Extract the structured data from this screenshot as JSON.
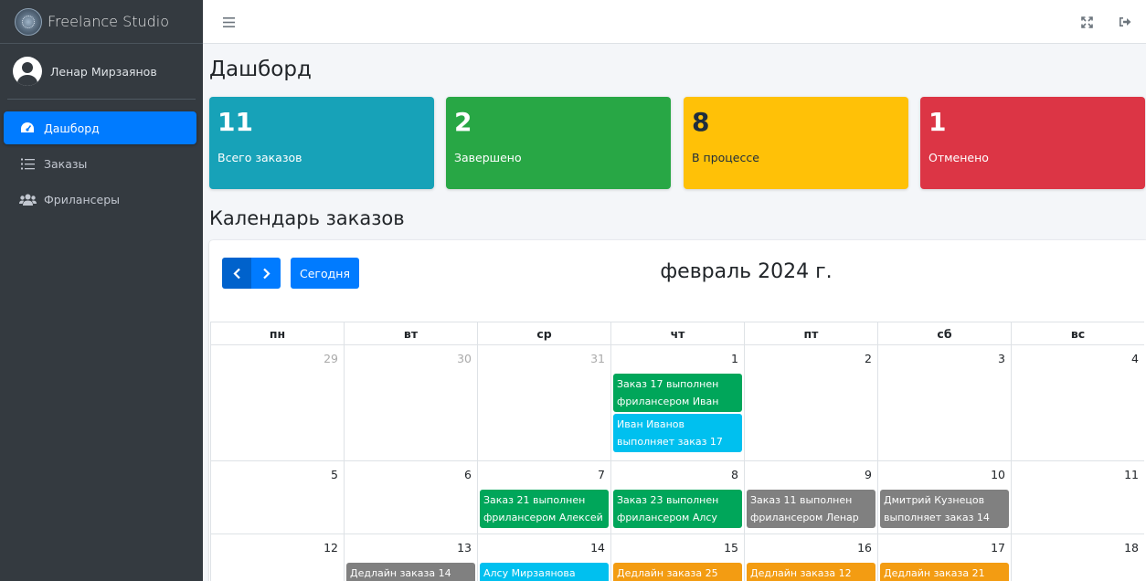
{
  "brand": {
    "name": "Freelance Studio"
  },
  "user": {
    "name": "Ленар Мирзаянов"
  },
  "nav": [
    {
      "label": "Дашборд",
      "icon": "tachometer-icon",
      "active": true
    },
    {
      "label": "Заказы",
      "icon": "list-icon",
      "active": false
    },
    {
      "label": "Фрилансеры",
      "icon": "users-icon",
      "active": false
    }
  ],
  "topbar": {
    "menu_icon": "hamburger-icon",
    "fullscreen_icon": "expand-icon",
    "logout_icon": "sign-out-icon"
  },
  "page": {
    "title": "Дашборд"
  },
  "stats": [
    {
      "value": "11",
      "label": "Всего заказов",
      "color": "#17a2b8"
    },
    {
      "value": "2",
      "label": "Завершено",
      "color": "#28a745"
    },
    {
      "value": "8",
      "label": "В процессе",
      "color": "#ffc107"
    },
    {
      "value": "1",
      "label": "Отменено",
      "color": "#dc3545"
    }
  ],
  "calendar": {
    "section_title": "Календарь заказов",
    "today_label": "Сегодня",
    "title": "февраль 2024 г.",
    "days_of_week": [
      "пн",
      "вт",
      "ср",
      "чт",
      "пт",
      "сб",
      "вс"
    ],
    "weeks": [
      [
        {
          "day": "29",
          "other": true,
          "events": []
        },
        {
          "day": "30",
          "other": true,
          "events": []
        },
        {
          "day": "31",
          "other": true,
          "events": []
        },
        {
          "day": "1",
          "events": [
            {
              "title": "Заказ 17 выполнен фрилансером Иван",
              "color": "#00a65a"
            },
            {
              "title": "Иван Иванов выполняет заказ 17",
              "color": "#00c0ef"
            }
          ]
        },
        {
          "day": "2",
          "events": []
        },
        {
          "day": "3",
          "events": []
        },
        {
          "day": "4",
          "events": []
        }
      ],
      [
        {
          "day": "5",
          "events": []
        },
        {
          "day": "6",
          "events": []
        },
        {
          "day": "7",
          "events": [
            {
              "title": "Заказ 21 выполнен фрилансером Алексей",
              "color": "#00a65a"
            }
          ]
        },
        {
          "day": "8",
          "events": [
            {
              "title": "Заказ 23 выполнен фрилансером Алсу",
              "color": "#00a65a"
            }
          ]
        },
        {
          "day": "9",
          "events": [
            {
              "title": "Заказ 11 выполнен фрилансером Ленар",
              "color": "#808080"
            }
          ]
        },
        {
          "day": "10",
          "events": [
            {
              "title": "Дмитрий Кузнецов выполняет заказ 14",
              "color": "#808080"
            }
          ]
        },
        {
          "day": "11",
          "events": []
        }
      ],
      [
        {
          "day": "12",
          "events": []
        },
        {
          "day": "13",
          "events": [
            {
              "title": "Дедлайн заказа 14",
              "color": "#808080"
            }
          ]
        },
        {
          "day": "14",
          "events": [
            {
              "title": "Алсу Мирзаянова",
              "color": "#00c0ef"
            }
          ]
        },
        {
          "day": "15",
          "events": [
            {
              "title": "Дедлайн заказа 25",
              "color": "#f39c12"
            }
          ]
        },
        {
          "day": "16",
          "events": [
            {
              "title": "Дедлайн заказа 12",
              "color": "#f39c12"
            }
          ]
        },
        {
          "day": "17",
          "events": [
            {
              "title": "Дедлайн заказа 21",
              "color": "#f39c12"
            }
          ]
        },
        {
          "day": "18",
          "events": []
        }
      ]
    ]
  }
}
